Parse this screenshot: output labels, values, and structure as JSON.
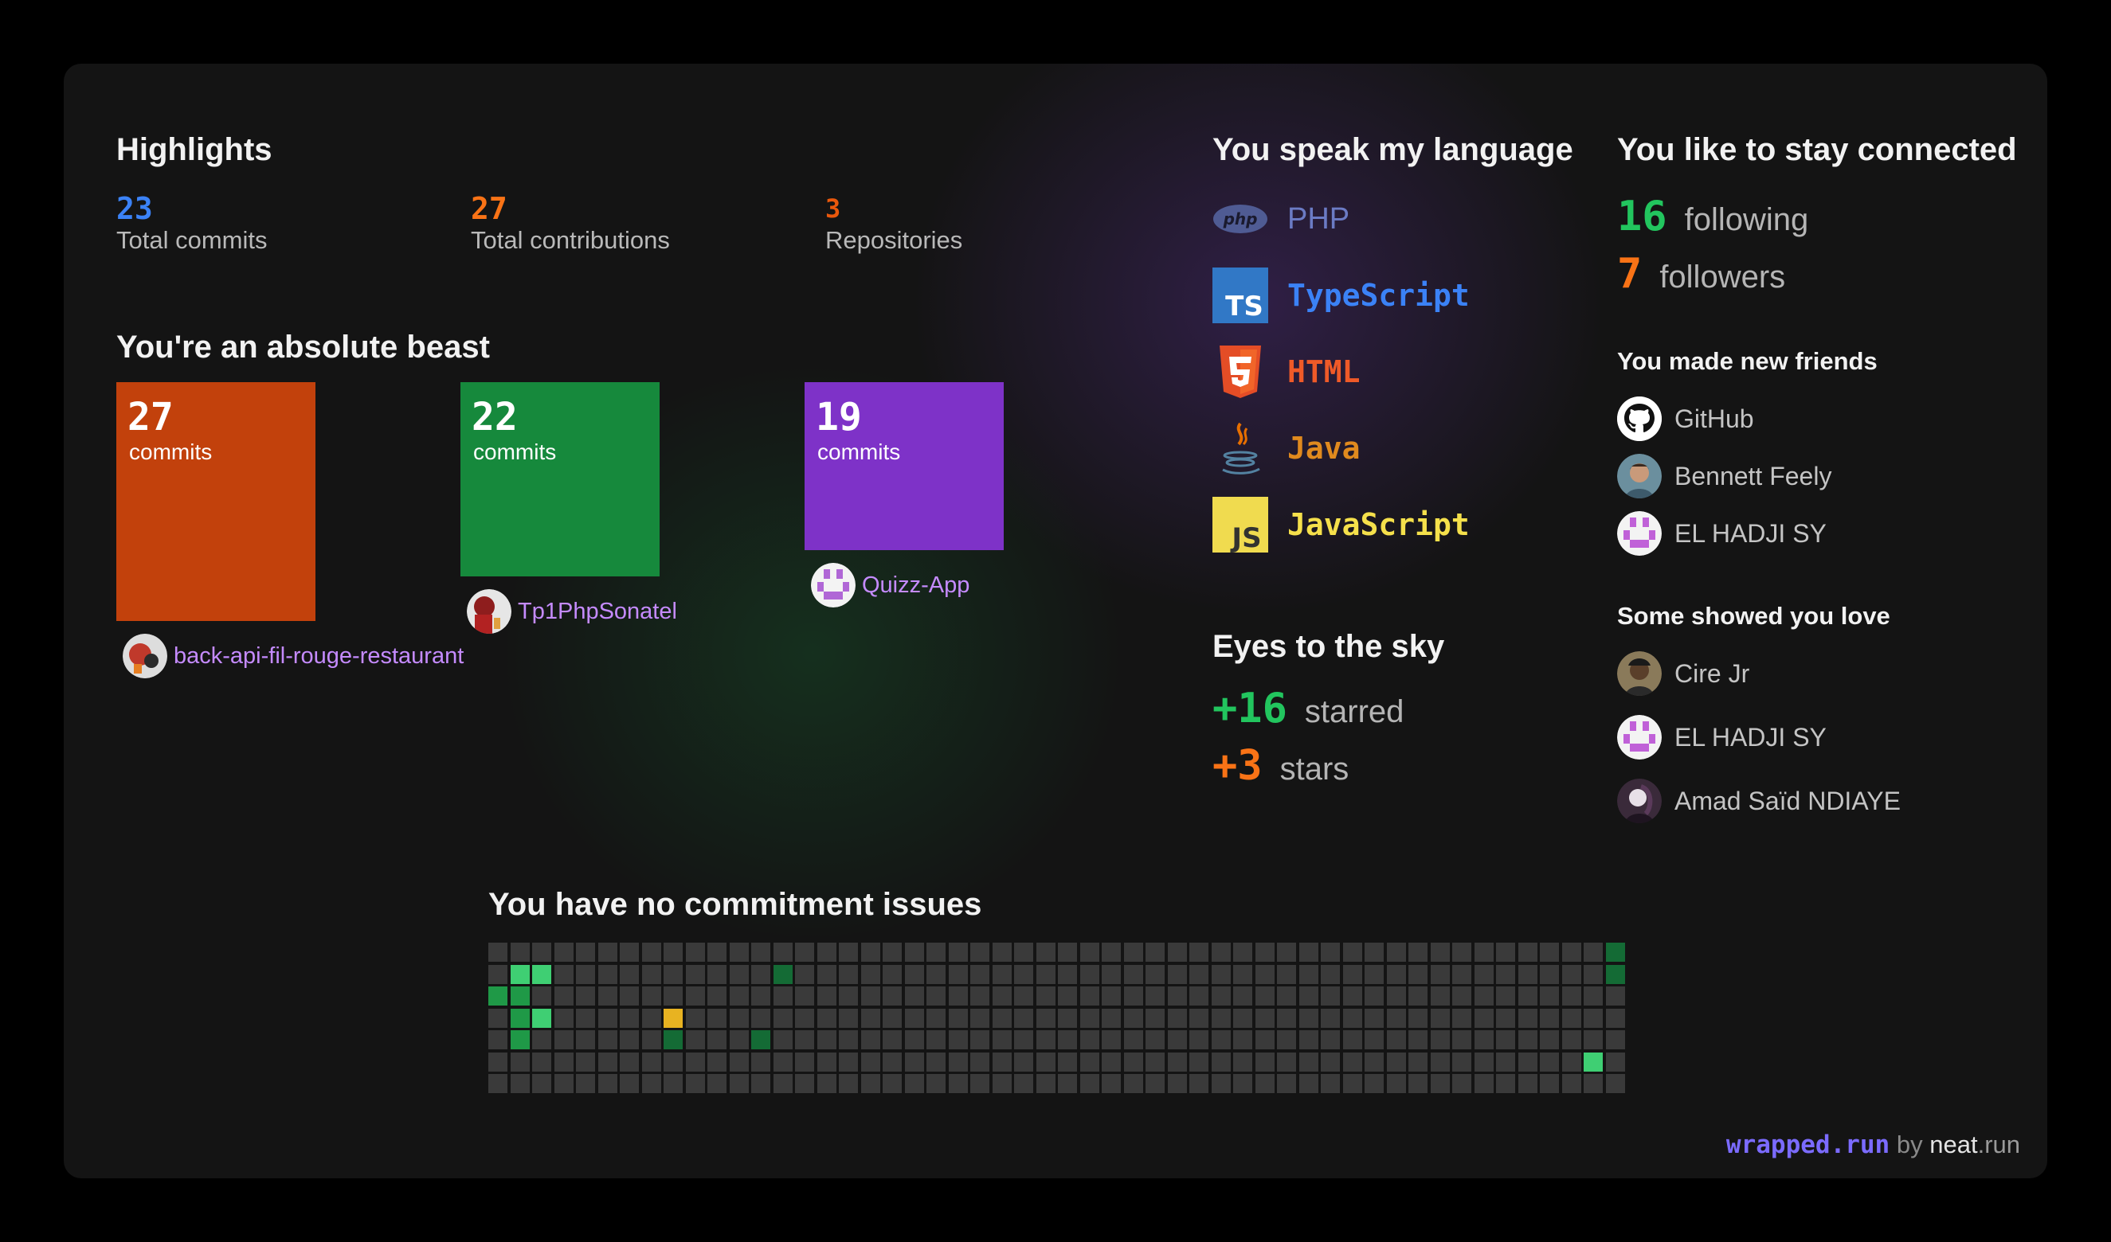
{
  "highlights": {
    "title": "Highlights",
    "items": [
      {
        "value": "23",
        "label": "Total commits",
        "color": "#3b82f6"
      },
      {
        "value": "27",
        "label": "Total contributions",
        "color": "#f97316"
      },
      {
        "value": "3",
        "label": "Repositories",
        "color": "#ea580c"
      }
    ]
  },
  "beast": {
    "title": "You're an absolute beast",
    "commits_label": "commits",
    "repos": [
      {
        "commits": 27,
        "name": "back-api-fil-rouge-restaurant",
        "color": "#c2410c"
      },
      {
        "commits": 22,
        "name": "Tp1PhpSonatel",
        "color": "#16893c"
      },
      {
        "commits": 19,
        "name": "Quizz-App",
        "color": "#7e32c8"
      }
    ]
  },
  "languages": {
    "title": "You speak my language",
    "items": [
      {
        "name": "PHP",
        "color": "#6b7bc4",
        "icon": "php-icon"
      },
      {
        "name": "TypeScript",
        "color": "#3b82f6",
        "icon": "typescript-icon"
      },
      {
        "name": "HTML",
        "color": "#ef5a28",
        "icon": "html5-icon"
      },
      {
        "name": "Java",
        "color": "#e08a1e",
        "icon": "java-icon"
      },
      {
        "name": "JavaScript",
        "color": "#f5e04b",
        "icon": "javascript-icon"
      }
    ]
  },
  "sky": {
    "title": "Eyes to the sky",
    "starred": {
      "value": "+16",
      "label": "starred",
      "color": "#22c55e"
    },
    "stars": {
      "value": "+3",
      "label": "stars",
      "color": "#f97316"
    }
  },
  "connected": {
    "title": "You like to stay connected",
    "following": {
      "value": "16",
      "label": "following",
      "color": "#22c55e"
    },
    "followers": {
      "value": "7",
      "label": "followers",
      "color": "#f97316"
    }
  },
  "friends": {
    "title": "You made new friends",
    "items": [
      {
        "name": "GitHub",
        "avatar": "github-icon"
      },
      {
        "name": "Bennett Feely",
        "avatar": "avatar"
      },
      {
        "name": "EL HADJI SY",
        "avatar": "identicon-avatar"
      }
    ]
  },
  "love": {
    "title": "Some showed you love",
    "items": [
      {
        "name": "Cire Jr",
        "avatar": "avatar"
      },
      {
        "name": "EL HADJI SY",
        "avatar": "identicon-avatar"
      },
      {
        "name": "Amad Saïd NDIAYE",
        "avatar": "avatar"
      }
    ]
  },
  "commitment": {
    "title": "You have no commitment issues",
    "weeks": 52,
    "days": 7,
    "colors": {
      "empty": "#3a3a3a",
      "level1": "#146b35",
      "level2": "#1f9947",
      "level3": "#3fcf73",
      "highlight": "#e8b321"
    },
    "active_cells": [
      {
        "week": 0,
        "day": 2,
        "level": "level2"
      },
      {
        "week": 1,
        "day": 1,
        "level": "level3"
      },
      {
        "week": 1,
        "day": 2,
        "level": "level2"
      },
      {
        "week": 1,
        "day": 3,
        "level": "level2"
      },
      {
        "week": 1,
        "day": 4,
        "level": "level2"
      },
      {
        "week": 2,
        "day": 1,
        "level": "level3"
      },
      {
        "week": 2,
        "day": 3,
        "level": "level3"
      },
      {
        "week": 8,
        "day": 3,
        "level": "highlight"
      },
      {
        "week": 8,
        "day": 4,
        "level": "level1"
      },
      {
        "week": 12,
        "day": 4,
        "level": "level1"
      },
      {
        "week": 13,
        "day": 1,
        "level": "level1"
      },
      {
        "week": 50,
        "day": 5,
        "level": "level3"
      },
      {
        "week": 51,
        "day": 0,
        "level": "level1"
      },
      {
        "week": 51,
        "day": 1,
        "level": "level1"
      }
    ]
  },
  "footer": {
    "brand": "wrapped.run",
    "by": "by",
    "neat": "neat",
    "run": ".run"
  }
}
